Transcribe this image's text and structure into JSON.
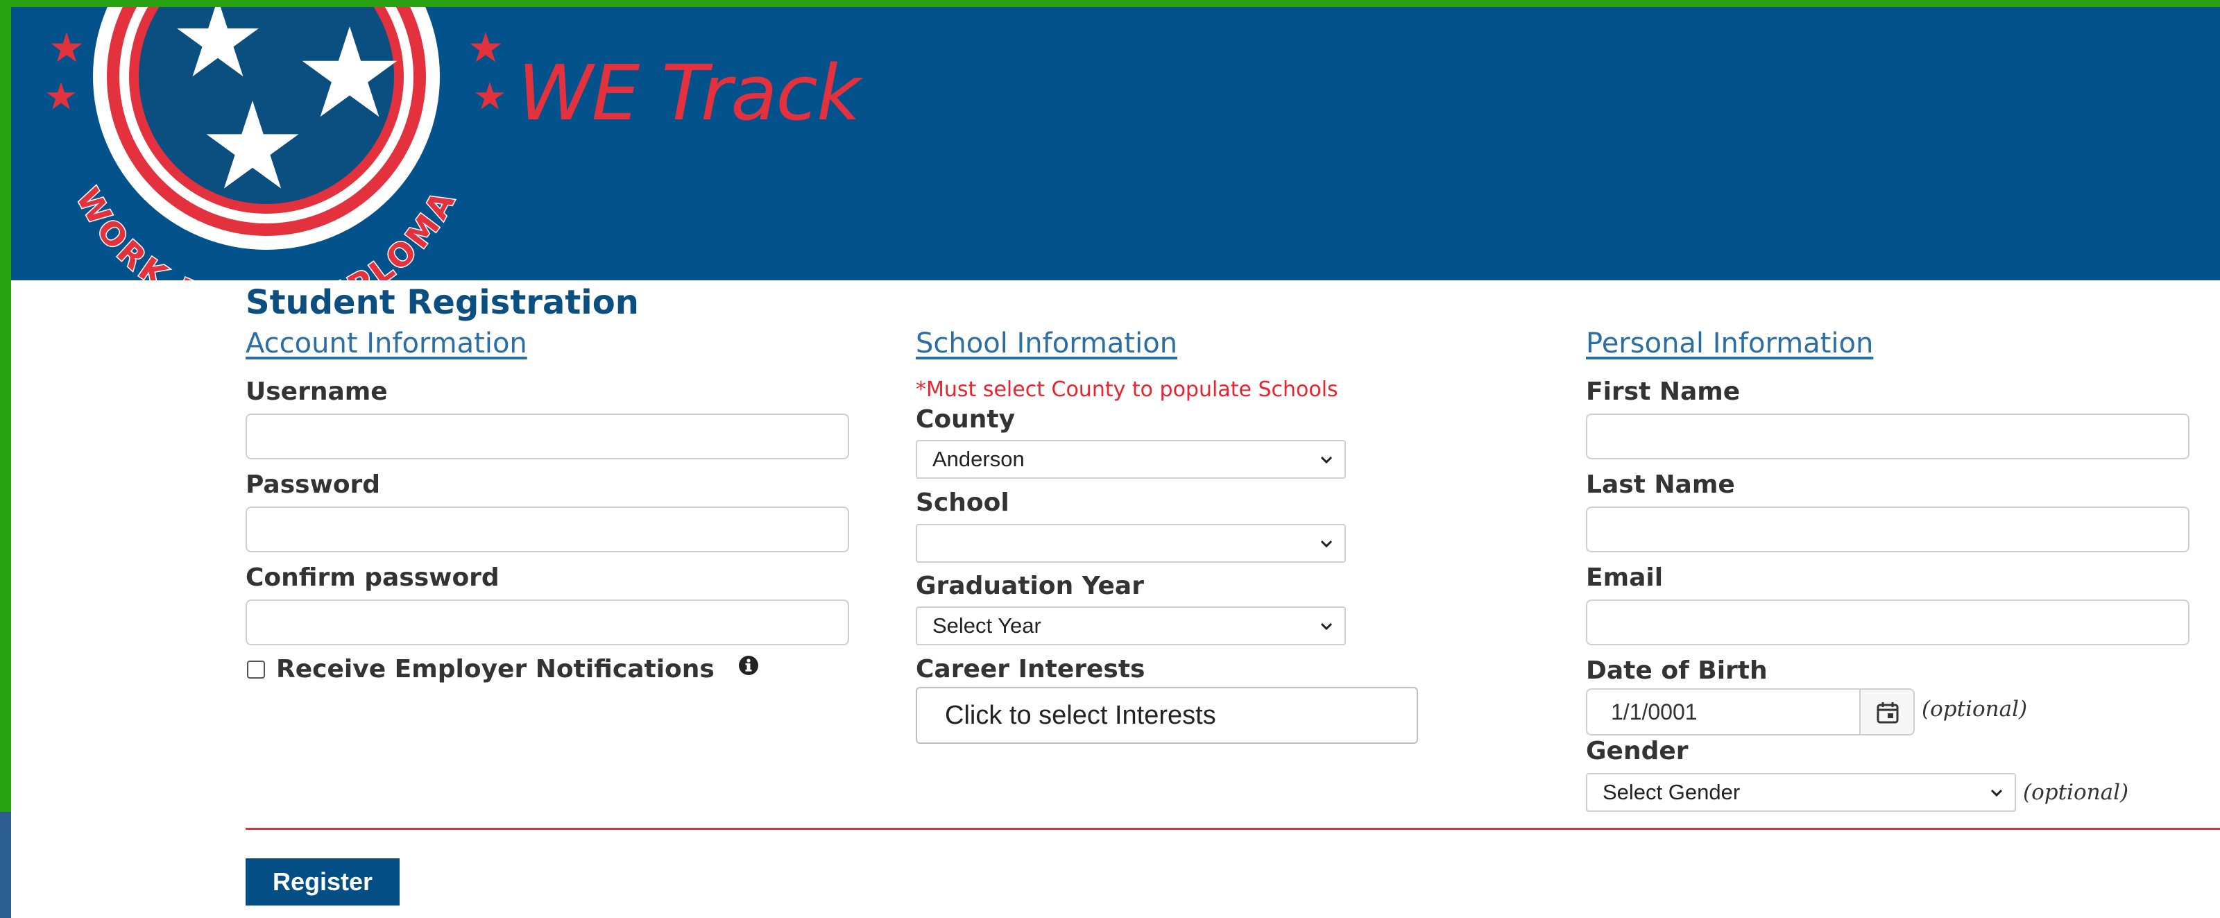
{
  "header": {
    "logo_text": "WORK ETHIC DIPLOMA",
    "app_title": "WE Track"
  },
  "page_title": "Student Registration",
  "account": {
    "section_title": "Account Information",
    "username_label": "Username",
    "username_value": "",
    "password_label": "Password",
    "password_value": "",
    "confirm_label": "Confirm password",
    "confirm_value": "",
    "notifications_label": "Receive Employer Notifications",
    "notifications_checked": false
  },
  "school": {
    "section_title": "School Information",
    "note": "*Must select County to populate Schools",
    "county_label": "County",
    "county_selected": "Anderson",
    "school_label": "School",
    "school_selected": "",
    "grad_year_label": "Graduation Year",
    "grad_year_selected": "Select Year",
    "career_label": "Career Interests",
    "career_button": "Click to select Interests"
  },
  "personal": {
    "section_title": "Personal Information",
    "first_name_label": "First Name",
    "first_name_value": "",
    "last_name_label": "Last Name",
    "last_name_value": "",
    "email_label": "Email",
    "email_value": "",
    "dob_label": "Date of Birth",
    "dob_value": "1/1/0001",
    "dob_optional": "(optional)",
    "gender_label": "Gender",
    "gender_selected": "Select Gender",
    "gender_optional": "(optional)"
  },
  "actions": {
    "register_label": "Register"
  },
  "colors": {
    "header_blue": "#03528c",
    "accent_red": "#e3323d",
    "frame_green": "#2aa312",
    "button_blue": "#044e86"
  }
}
